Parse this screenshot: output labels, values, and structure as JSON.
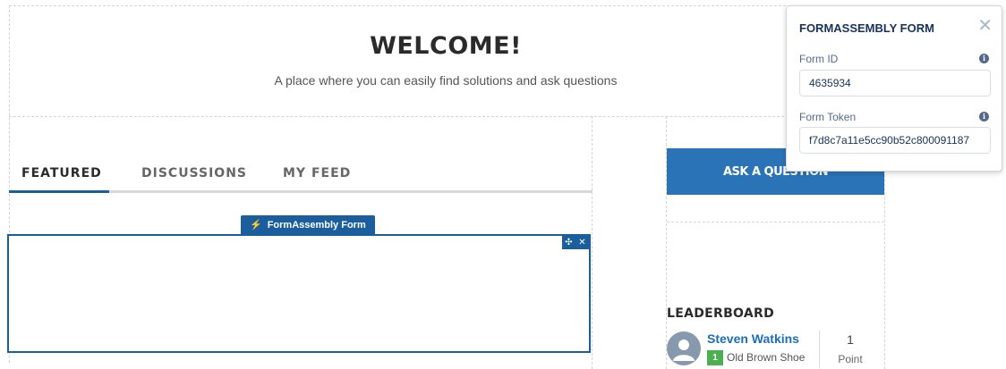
{
  "header": {
    "title": "WELCOME!",
    "subtitle": "A place where you can easily find solutions and ask questions"
  },
  "tabs": [
    {
      "label": "FEATURED",
      "active": true
    },
    {
      "label": "DISCUSSIONS",
      "active": false
    },
    {
      "label": "MY FEED",
      "active": false
    }
  ],
  "component": {
    "label": "FormAssembly Form",
    "bolt_icon": "⚡",
    "move_icon": "✣",
    "close_icon": "✕"
  },
  "ask_button": {
    "label": "ASK A QUESTION"
  },
  "leaderboard": {
    "title": "LEADERBOARD",
    "entries": [
      {
        "name": "Steven Watkins",
        "rank": "1",
        "rank_title": "Old Brown Shoe",
        "points": "1",
        "points_label": "Point"
      }
    ]
  },
  "panel": {
    "title": "FORMASSEMBLY FORM",
    "close_icon": "✕",
    "info_icon": "i",
    "fields": [
      {
        "label": "Form ID",
        "value": "4635934"
      },
      {
        "label": "Form Token",
        "value": "f7d8c7a11e5cc90b52c800091187"
      }
    ]
  },
  "colors": {
    "brand_blue": "#1b5e9e",
    "button_blue": "#2b73b7",
    "link_blue": "#1b6fb8",
    "badge_green": "#4caf50"
  }
}
